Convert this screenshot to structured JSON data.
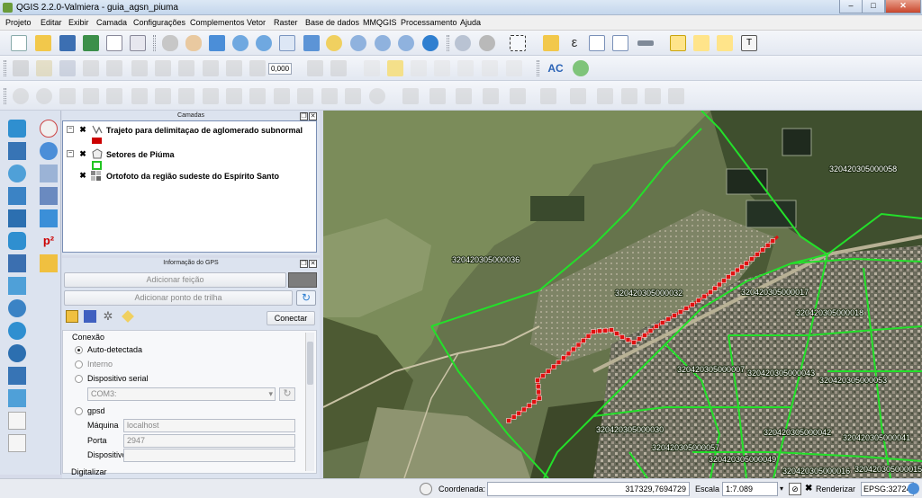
{
  "window": {
    "title": "QGIS 2.2.0-Valmiera - guia_agsn_piuma",
    "controls": [
      "–",
      "□",
      "✕"
    ]
  },
  "menu": [
    "Projeto",
    "Editar",
    "Exibir",
    "Camada",
    "Configurações",
    "Complementos",
    "Vetor",
    "Raster",
    "Base de dados",
    "MMQGIS",
    "Processamento",
    "Ajuda"
  ],
  "toolbar2": {
    "scale_value": "0,000",
    "ac_label": "AC"
  },
  "layers_panel": {
    "title": "Camadas",
    "layers": [
      {
        "name": "Trajeto para delimitaçao de aglomerado subnormal",
        "symbol_color": "#cc0000"
      },
      {
        "name": "Setores de Piúma",
        "symbol_color": "#22c422"
      },
      {
        "name": "Ortofoto da região sudeste do Espírito Santo"
      }
    ]
  },
  "gps_panel": {
    "title": "Informação do GPS",
    "add_feature_label": "Adicionar feição",
    "add_track_point_label": "Adicionar ponto de trilha",
    "connect_label": "Conectar",
    "connection_group": "Conexão",
    "options": [
      "Auto-detectada",
      "Interno",
      "Dispositivo serial"
    ],
    "port_select": "COM3:",
    "gpsd_label": "gpsd",
    "host_label": "Máquina",
    "host_value": "localhost",
    "port_label": "Porta",
    "port_value": "2947",
    "device_label": "Dispositivo",
    "device_value": "",
    "digitize_group": "Digitalizar"
  },
  "map": {
    "sector_labels": [
      "320420305000058",
      "320420305000036",
      "320420305000032",
      "320420305000017",
      "320420305000018",
      "320420305000007",
      "320420305000043",
      "320420305000053",
      "320420305000030",
      "320420305000042",
      "320420305000041",
      "320420305000057",
      "320420305000049",
      "320420305000016",
      "320420305000015"
    ]
  },
  "status_bar": {
    "coord_label": "Coordenada:",
    "coord_value": "317329,7694729",
    "scale_label": "Escala",
    "scale_value": "1:7.089",
    "render_label": "Renderizar",
    "crs": "EPSG:32724"
  }
}
